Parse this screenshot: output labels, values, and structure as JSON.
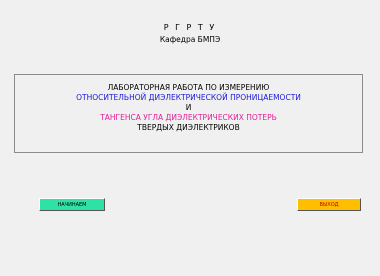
{
  "header": {
    "university": "Р Г Р Т У",
    "department": "Кафедра БМПЭ"
  },
  "title": {
    "line1": "ЛАБОРАТОРНАЯ  РАБОТА ПО  ИЗМЕРЕНИЮ",
    "line2": "ОТНОСИТЕЛЬНОЙ  ДИЭЛЕКТРИЧЕСКОЙ  ПРОНИЦАЕМОСТИ",
    "line3": "И",
    "line4": "ТАНГЕНСА  УГЛА  ДИЭЛЕКТРИЧЕСКИХ  ПОТЕРЬ",
    "line5": "ТВЕРДЫХ  ДИЭЛЕКТРИКОВ"
  },
  "buttons": {
    "start_label": "НАЧИНАЕМ",
    "exit_label": "ВЫХОД"
  },
  "colors": {
    "background": "#f0f0f0",
    "title_blue": "#1a18d6",
    "title_magenta": "#e0209a",
    "start_button": "#2ee2a3",
    "exit_button": "#ffbf00",
    "exit_text": "#c00000"
  }
}
